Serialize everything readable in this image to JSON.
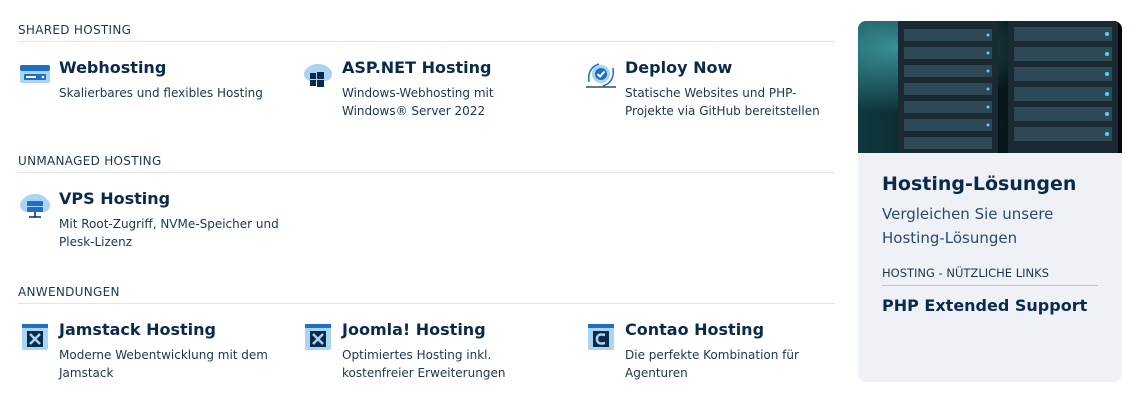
{
  "sections": [
    {
      "heading": "SHARED HOSTING",
      "items": [
        {
          "title": "Webhosting",
          "desc": "Skalierbares und flexibles Hosting",
          "icon": "server-stack-icon"
        },
        {
          "title": "ASP.NET Hosting",
          "desc": "Windows-Webhosting mit Windows® Server 2022",
          "icon": "windows-cloud-icon"
        },
        {
          "title": "Deploy Now",
          "desc": "Statische Websites und PHP-Projekte via GitHub bereitstellen",
          "icon": "deploy-check-icon"
        }
      ]
    },
    {
      "heading": "UNMANAGED HOSTING",
      "items": [
        {
          "title": "VPS Hosting",
          "desc": "Mit Root-Zugriff, NVMe-Speicher und Plesk-Lizenz",
          "icon": "cloud-server-icon"
        }
      ]
    },
    {
      "heading": "ANWENDUNGEN",
      "items": [
        {
          "title": "Jamstack Hosting",
          "desc": "Moderne Webentwicklung mit dem Jamstack",
          "icon": "joomla-window-icon"
        },
        {
          "title": "Joomla! Hosting",
          "desc": "Optimiertes Hosting inkl. kostenfreier Erweiterungen",
          "icon": "joomla-window-icon"
        },
        {
          "title": "Contao Hosting",
          "desc": "Die perfekte Kombination für Agenturen",
          "icon": "contao-window-icon"
        }
      ]
    }
  ],
  "panel": {
    "title": "Hosting-Lösungen",
    "subtitle": "Vergleichen Sie unsere Hosting-Lösungen",
    "links_heading": "HOSTING - NÜTZLICHE LINKS",
    "links": [
      "PHP Extended Support"
    ],
    "image": "server-rack-photo"
  },
  "colors": {
    "text_dark": "#0b2a4a",
    "icon_blue": "#1f6fc5",
    "icon_light": "#a9d4f2",
    "panel_bg": "#eef2f7"
  }
}
